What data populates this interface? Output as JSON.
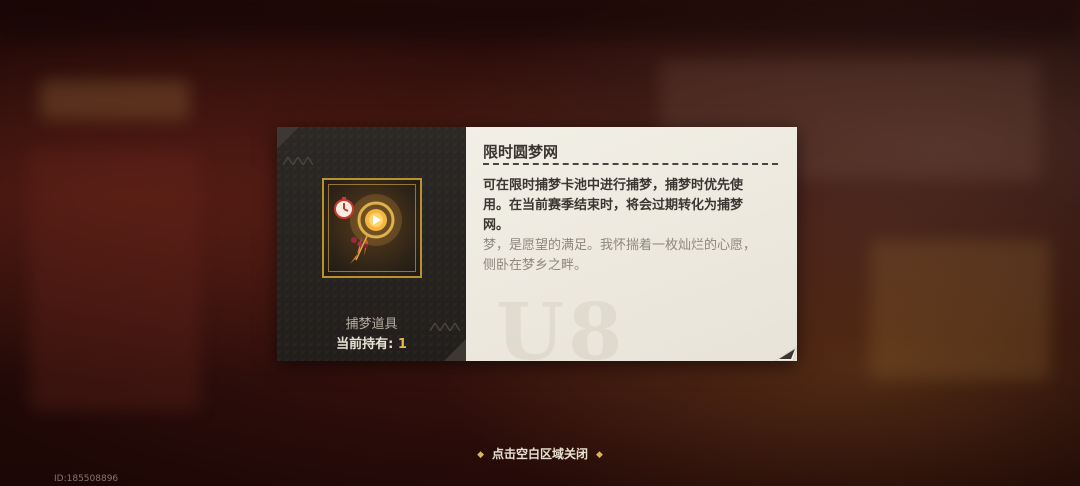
{
  "item": {
    "title": "限时圆梦网",
    "category": "捕梦道具",
    "count_label": "当前持有:",
    "count_value": "1",
    "description": "可在限时捕梦卡池中进行捕梦，捕梦时优先使用。在当前赛季结束时，将会过期转化为捕梦网。",
    "flavor": "梦，是愿望的满足。我怀揣着一枚灿烂的心愿，侧卧在梦乡之畔。",
    "icon": "dream-catcher-icon"
  },
  "watermark": "U8",
  "footer": {
    "close_hint": "点击空白区域关闭",
    "left_glyph": "◆",
    "right_glyph": "◆"
  },
  "uid": "ID:185508896",
  "colors": {
    "accent_gold": "#e8b84a",
    "frame_gold": "#b8922e",
    "card_dark": "#26221f",
    "card_light": "#f2efe6"
  }
}
